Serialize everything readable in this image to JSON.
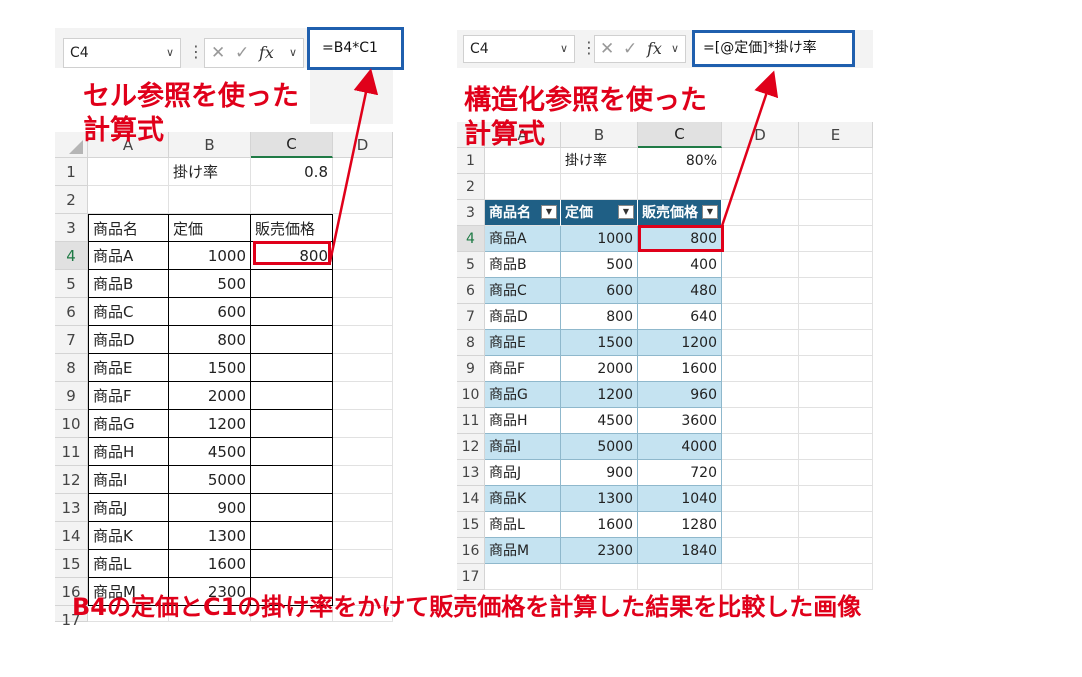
{
  "left": {
    "name_box": "C4",
    "formula": "=B4*C1",
    "callout_line1": "セル参照を使った",
    "callout_line2": "計算式",
    "col_headers": [
      "A",
      "B",
      "C",
      "D"
    ],
    "rows": [
      {
        "n": "1",
        "a": "",
        "b": "掛け率",
        "c": "0.8"
      },
      {
        "n": "2",
        "a": "",
        "b": "",
        "c": ""
      },
      {
        "n": "3",
        "a": "商品名",
        "b": "定価",
        "c": "販売価格"
      },
      {
        "n": "4",
        "a": "商品A",
        "b": "1000",
        "c": "800"
      },
      {
        "n": "5",
        "a": "商品B",
        "b": "500",
        "c": ""
      },
      {
        "n": "6",
        "a": "商品C",
        "b": "600",
        "c": ""
      },
      {
        "n": "7",
        "a": "商品D",
        "b": "800",
        "c": ""
      },
      {
        "n": "8",
        "a": "商品E",
        "b": "1500",
        "c": ""
      },
      {
        "n": "9",
        "a": "商品F",
        "b": "2000",
        "c": ""
      },
      {
        "n": "10",
        "a": "商品G",
        "b": "1200",
        "c": ""
      },
      {
        "n": "11",
        "a": "商品H",
        "b": "4500",
        "c": ""
      },
      {
        "n": "12",
        "a": "商品I",
        "b": "5000",
        "c": ""
      },
      {
        "n": "13",
        "a": "商品J",
        "b": "900",
        "c": ""
      },
      {
        "n": "14",
        "a": "商品K",
        "b": "1300",
        "c": ""
      },
      {
        "n": "15",
        "a": "商品L",
        "b": "1600",
        "c": ""
      },
      {
        "n": "16",
        "a": "商品M",
        "b": "2300",
        "c": ""
      },
      {
        "n": "17",
        "a": "",
        "b": "",
        "c": ""
      }
    ]
  },
  "right": {
    "name_box": "C4",
    "formula": "=[@定価]*掛け率",
    "callout_line1": "構造化参照を使った",
    "callout_line2": "計算式",
    "col_headers": [
      "A",
      "B",
      "C",
      "D",
      "E"
    ],
    "rows": [
      {
        "n": "1",
        "a": "",
        "b": "掛け率",
        "c": "80%"
      },
      {
        "n": "2",
        "a": "",
        "b": "",
        "c": ""
      },
      {
        "n": "3",
        "a": "商品名",
        "b": "定価",
        "c": "販売価格"
      },
      {
        "n": "4",
        "a": "商品A",
        "b": "1000",
        "c": "800"
      },
      {
        "n": "5",
        "a": "商品B",
        "b": "500",
        "c": "400"
      },
      {
        "n": "6",
        "a": "商品C",
        "b": "600",
        "c": "480"
      },
      {
        "n": "7",
        "a": "商品D",
        "b": "800",
        "c": "640"
      },
      {
        "n": "8",
        "a": "商品E",
        "b": "1500",
        "c": "1200"
      },
      {
        "n": "9",
        "a": "商品F",
        "b": "2000",
        "c": "1600"
      },
      {
        "n": "10",
        "a": "商品G",
        "b": "1200",
        "c": "960"
      },
      {
        "n": "11",
        "a": "商品H",
        "b": "4500",
        "c": "3600"
      },
      {
        "n": "12",
        "a": "商品I",
        "b": "5000",
        "c": "4000"
      },
      {
        "n": "13",
        "a": "商品J",
        "b": "900",
        "c": "720"
      },
      {
        "n": "14",
        "a": "商品K",
        "b": "1300",
        "c": "1040"
      },
      {
        "n": "15",
        "a": "商品L",
        "b": "1600",
        "c": "1280"
      },
      {
        "n": "16",
        "a": "商品M",
        "b": "2300",
        "c": "1840"
      },
      {
        "n": "17",
        "a": "",
        "b": "",
        "c": ""
      }
    ]
  },
  "caption": "B4の定価とC1の掛け率をかけて販売価格を計算した結果を比較した画像",
  "colors": {
    "accent_red": "#e0001a",
    "highlight_blue": "#1f5fae",
    "table_header": "#1f5f85",
    "table_band": "#c5e3f1",
    "selection_green": "#1f7a45"
  }
}
